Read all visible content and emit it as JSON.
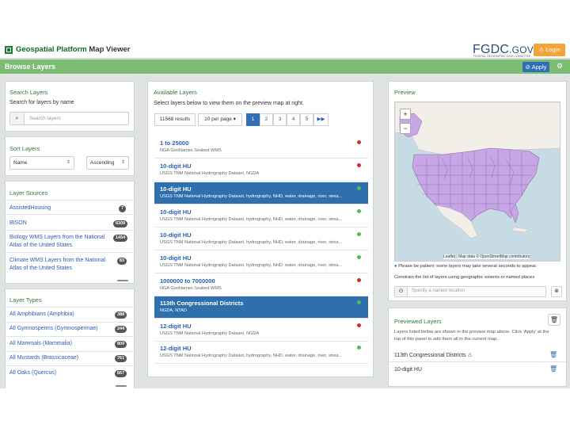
{
  "header": {
    "app_title_part1": "Geospatial Platform",
    "app_title_part2": "Map Viewer",
    "fgdc_logo": "FGDC",
    "fgdc_gov": ".GOV",
    "fgdc_sub": "FEDERAL GEOGRAPHIC DATA COMMITTEE",
    "login_label": "⚠ Login"
  },
  "toolbar": {
    "title": "Browse Layers",
    "apply_label": "Apply",
    "settings_icon": "gear-icon"
  },
  "search": {
    "title": "Search Layers",
    "subtitle": "Search for layers by name",
    "placeholder": "Search layers"
  },
  "sort": {
    "title": "Sort Layers",
    "field": "Name",
    "order": "Ascending"
  },
  "sources": {
    "title": "Layer Sources",
    "items": [
      {
        "label": "AssistedHousing",
        "count": "7"
      },
      {
        "label": "BISON",
        "count": "6309"
      },
      {
        "label": "Biology WMS Layers from the National",
        "label2": "Atlas of the United States",
        "count": "1454"
      },
      {
        "label": "Climate WMS Layers from the National",
        "label2": "Atlas of the United States",
        "count": "83"
      }
    ]
  },
  "types": {
    "title": "Layer Types",
    "items": [
      {
        "label": "All Amphibians (Amphibia)",
        "count": "388"
      },
      {
        "label": "All Gymnosperms (Gymnospermae)",
        "count": "244"
      },
      {
        "label": "All Mammals (Mammalia)",
        "count": "809"
      },
      {
        "label": "All Mustards (Brassicaceae)",
        "count": "761"
      },
      {
        "label": "All Oaks (Quercus)",
        "count": "667"
      }
    ]
  },
  "available": {
    "title": "Available Layers",
    "subtitle": "Select layers below to view them on the preview map at right.",
    "results": "11568 results",
    "per_page": "10 per page",
    "pages": [
      "1",
      "2",
      "3",
      "4",
      "5",
      "▶▶"
    ],
    "layers": [
      {
        "title": "1 to 25000",
        "desc": "NGA GeoNames Seabed WMS",
        "status": "red",
        "selected": false
      },
      {
        "title": "10-digit HU",
        "desc": "USGS TNM National Hydrography Dataset, NGDA",
        "status": "red",
        "selected": false
      },
      {
        "title": "10-digit HU",
        "desc": "USGS TNM National Hydrography Dataset, hydrography, NHD, water, drainage, river, strea...",
        "status": "green",
        "selected": true
      },
      {
        "title": "10-digit HU",
        "desc": "USGS TNM National Hydrography Dataset, hydrography, NHD, water, drainage, river, strea...",
        "status": "green",
        "selected": false
      },
      {
        "title": "10-digit HU",
        "desc": "USGS TNM National Hydrography Dataset, hydrography, NHD, water, drainage, river, strea...",
        "status": "green",
        "selected": false
      },
      {
        "title": "10-digit HU",
        "desc": "USGS TNM National Hydrography Dataset, hydrography, NHD, water, drainage, river, strea...",
        "status": "green",
        "selected": false
      },
      {
        "title": "1000000 to 7000000",
        "desc": "NGA GeoNames Seabed WMS",
        "status": "red",
        "selected": false
      },
      {
        "title": "113th Congressional Districts",
        "desc": "NGDA, NTAD",
        "status": "green",
        "selected": true
      },
      {
        "title": "12-digit HU",
        "desc": "USGS TNM National Hydrography Dataset, NGDA",
        "status": "red",
        "selected": false
      },
      {
        "title": "12-digit HU",
        "desc": "USGS TNM National Hydrography Dataset, hydrography, NHD, water, drainage, river, strea...",
        "status": "green",
        "selected": false
      }
    ]
  },
  "preview": {
    "title": "Preview",
    "zoom_in": "+",
    "zoom_out": "−",
    "attribution": "Leaflet | Map data © OpenStreetMap contributors",
    "note": "Please be patient: some layers may take several seconds to appear.",
    "constrain": "Constrain the list of layers using geographic extents or named places",
    "place_placeholder": "Specify a named location"
  },
  "previewed": {
    "title": "Previewed Layers",
    "desc1": "Layers listed below are shown in the preview map above. Click 'Apply' at the",
    "desc2": "top of this panel to add them all to the current map.",
    "items": [
      {
        "label": "113th Congressional Districts",
        "warning": true
      },
      {
        "label": "10-digit HU",
        "warning": false
      }
    ]
  }
}
